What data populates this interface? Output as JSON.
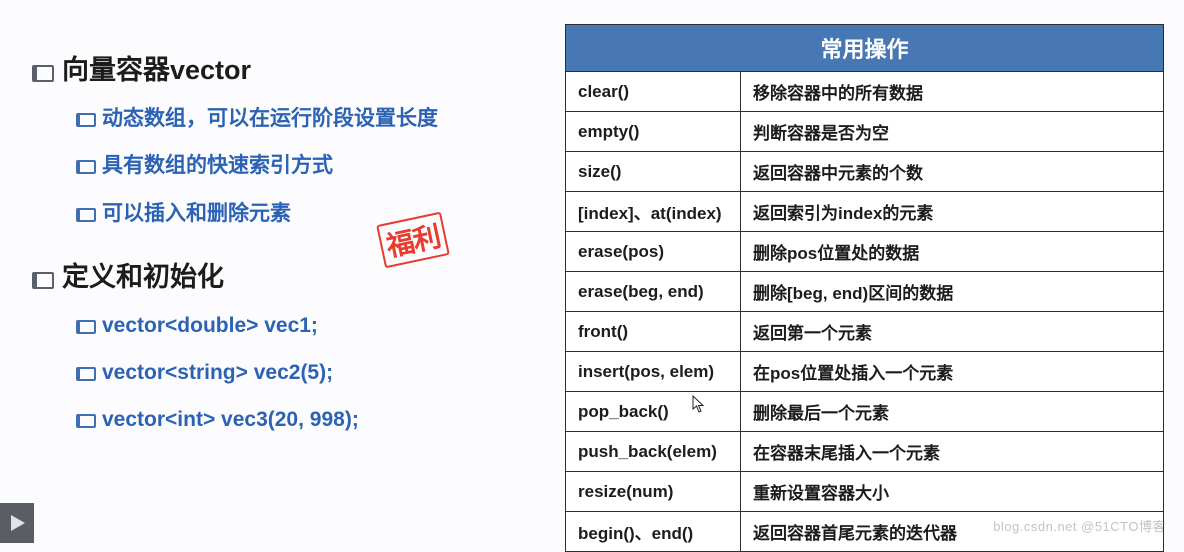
{
  "left": {
    "section1_title": "向量容器vector",
    "section1_items": [
      "动态数组，可以在运行阶段设置长度",
      "具有数组的快速索引方式",
      "可以插入和删除元素"
    ],
    "section2_title": "定义和初始化",
    "section2_items": [
      "vector<double> vec1;",
      "vector<string> vec2(5);",
      "vector<int> vec3(20, 998);"
    ],
    "stamp": "福利"
  },
  "table": {
    "header": "常用操作",
    "rows": [
      {
        "op": "clear()",
        "desc": "移除容器中的所有数据"
      },
      {
        "op": "empty()",
        "desc": "判断容器是否为空"
      },
      {
        "op": "size()",
        "desc": "返回容器中元素的个数"
      },
      {
        "op": "[index]、at(index)",
        "desc": "返回索引为index的元素"
      },
      {
        "op": "erase(pos)",
        "desc": "删除pos位置处的数据"
      },
      {
        "op": "erase(beg, end)",
        "desc": "删除[beg, end)区间的数据"
      },
      {
        "op": "front()",
        "desc": "返回第一个元素"
      },
      {
        "op": "insert(pos, elem)",
        "desc": "在pos位置处插入一个元素"
      },
      {
        "op": "pop_back()",
        "desc": "删除最后一个元素"
      },
      {
        "op": "push_back(elem)",
        "desc": "在容器末尾插入一个元素"
      },
      {
        "op": "resize(num)",
        "desc": "重新设置容器大小"
      },
      {
        "op": "begin()、end()",
        "desc": "返回容器首尾元素的迭代器"
      }
    ]
  },
  "watermark": "blog.csdn.net  @51CTO博客"
}
